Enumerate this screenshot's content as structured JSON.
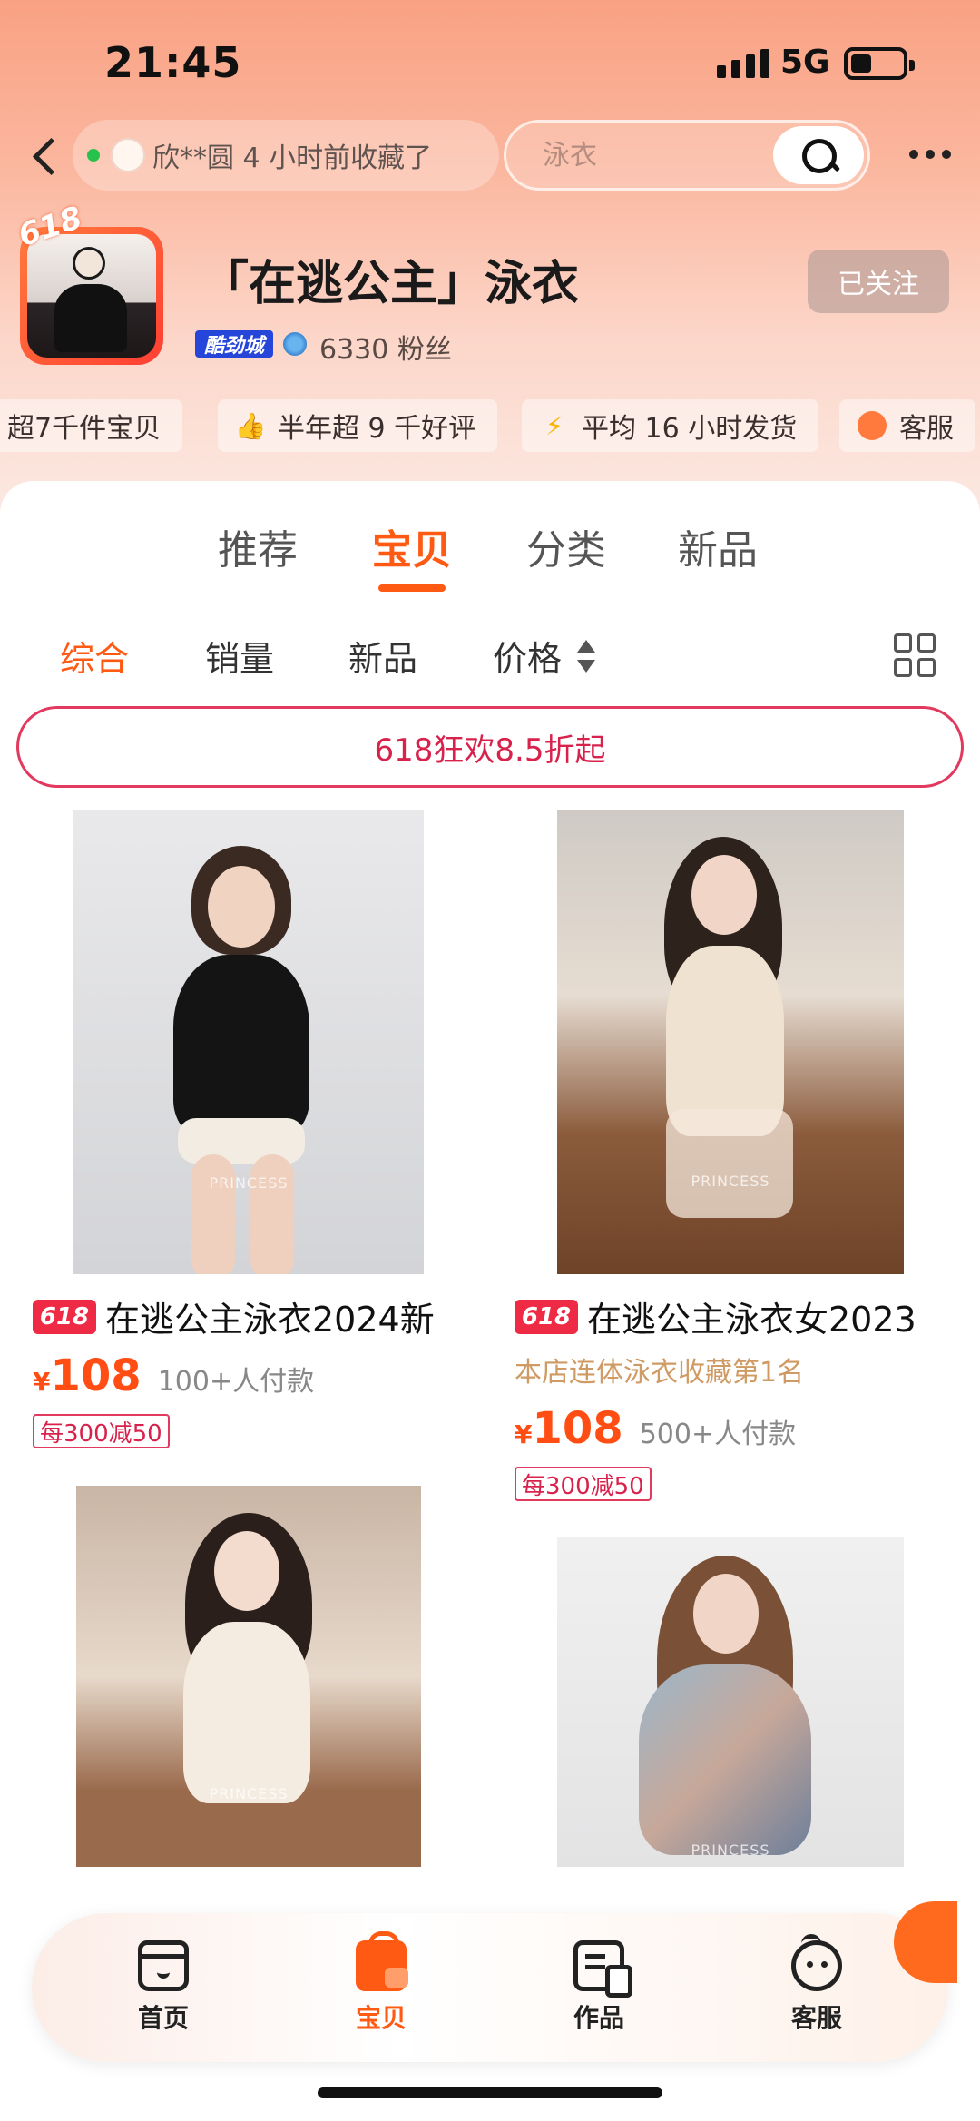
{
  "status_bar": {
    "time": "21:45",
    "network": "5G"
  },
  "nav": {
    "notice": "欣**圆 4 小时前收藏了",
    "search_placeholder": "泳衣"
  },
  "shop": {
    "logo_badge": "618",
    "name": "「在逃公主」泳衣",
    "level_badge": "酷劲城",
    "fans": "6330 粉丝",
    "follow_label": "已关注"
  },
  "stats": [
    {
      "icon": "shelf-icon",
      "text": "超7千件宝贝"
    },
    {
      "icon": "thumbs-up-icon",
      "text": "半年超 9 千好评"
    },
    {
      "icon": "lightning-icon",
      "text": "平均 16 小时发货"
    },
    {
      "icon": "customer-service-icon",
      "text": "客服"
    }
  ],
  "tabs": [
    "推荐",
    "宝贝",
    "分类",
    "新品"
  ],
  "active_tab": "宝贝",
  "sorts": [
    "综合",
    "销量",
    "新品",
    "价格"
  ],
  "active_sort": "综合",
  "promo_banner": "618狂欢8.5折起",
  "products": [
    {
      "tag": "618",
      "title": "在逃公主泳衣2024新",
      "rank": "",
      "currency": "¥",
      "price": "108",
      "paid": "100+人付款",
      "coupon": "每300减50",
      "watermark": "PRINCESS"
    },
    {
      "tag": "618",
      "title": "在逃公主泳衣女2023",
      "rank": "本店连体泳衣收藏第1名",
      "currency": "¥",
      "price": "108",
      "paid": "500+人付款",
      "coupon": "每300减50",
      "watermark": "PRINCESS"
    },
    {
      "tag": "",
      "title": "",
      "rank": "",
      "currency": "¥",
      "price": "",
      "paid": "",
      "coupon": "",
      "watermark": "PRINCESS"
    },
    {
      "tag": "",
      "title": "",
      "rank": "",
      "currency": "",
      "price": "",
      "paid": "",
      "coupon": "",
      "watermark": "PRINCESS"
    }
  ],
  "tabbar": [
    {
      "icon": "storefront-icon",
      "label": "首页"
    },
    {
      "icon": "shopping-bag-icon",
      "label": "宝贝"
    },
    {
      "icon": "works-icon",
      "label": "作品"
    },
    {
      "icon": "customer-service-face-icon",
      "label": "客服"
    }
  ],
  "active_tabbar": "宝贝",
  "colors": {
    "accent": "#ff5a14",
    "price": "#ff4d14",
    "promo": "#e23a5e",
    "tag618": "#ee2a45"
  }
}
